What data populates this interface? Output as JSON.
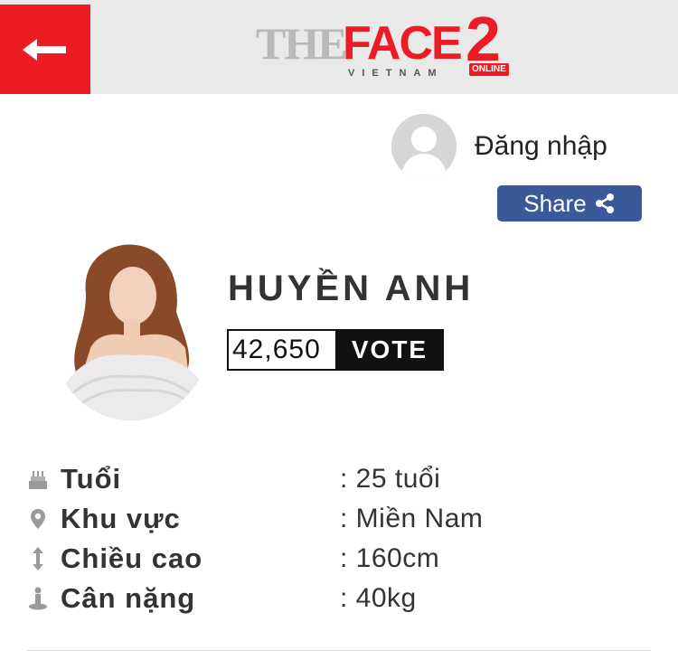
{
  "header": {
    "back_icon": "arrow-left-icon",
    "logo": {
      "the": "THE",
      "face": "FACE",
      "number": "2",
      "vietnam": "VIETNAM",
      "online": "ONLINE"
    }
  },
  "login": {
    "label": "Đăng nhập",
    "avatar_icon": "user-silhouette-icon"
  },
  "share": {
    "label": "Share",
    "icon": "share-icon"
  },
  "profile": {
    "name": "HUYỀN ANH",
    "votes": "42,650",
    "vote_label": "VOTE"
  },
  "info": [
    {
      "icon": "cake-icon",
      "label": "Tuổi",
      "value": ": 25 tuổi"
    },
    {
      "icon": "location-pin-icon",
      "label": "Khu vực",
      "value": ": Miền Nam"
    },
    {
      "icon": "height-arrow-icon",
      "label": "Chiều cao",
      "value": ": 160cm"
    },
    {
      "icon": "weight-scale-icon",
      "label": "Cân nặng",
      "value": ": 40kg"
    }
  ],
  "colors": {
    "brand_red": "#ed1c24",
    "share_blue": "#3b5998",
    "header_bg": "#e9e9e9"
  }
}
